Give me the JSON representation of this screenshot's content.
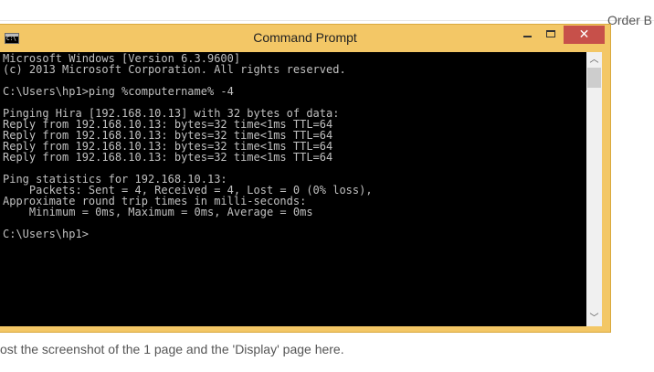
{
  "background": {
    "top_right_text": "Order B",
    "caption_text": "ost the screenshot of the 1 page and the 'Display' page here."
  },
  "window": {
    "title": "Command Prompt",
    "icon_text": "C:\\",
    "close_symbol": "✕",
    "scroll_up_symbol": "︿",
    "scroll_down_symbol": "﹀"
  },
  "console": {
    "lines": [
      "Microsoft Windows [Version 6.3.9600]",
      "(c) 2013 Microsoft Corporation. All rights reserved.",
      "",
      "C:\\Users\\hp1>ping %computername% -4",
      "",
      "Pinging Hira [192.168.10.13] with 32 bytes of data:",
      "Reply from 192.168.10.13: bytes=32 time<1ms TTL=64",
      "Reply from 192.168.10.13: bytes=32 time<1ms TTL=64",
      "Reply from 192.168.10.13: bytes=32 time<1ms TTL=64",
      "Reply from 192.168.10.13: bytes=32 time<1ms TTL=64",
      "",
      "Ping statistics for 192.168.10.13:",
      "    Packets: Sent = 4, Received = 4, Lost = 0 (0% loss),",
      "Approximate round trip times in milli-seconds:",
      "    Minimum = 0ms, Maximum = 0ms, Average = 0ms",
      "",
      "C:\\Users\\hp1>"
    ]
  },
  "colors": {
    "titlebar": "#f3c766",
    "close_button": "#c7504a",
    "console_bg": "#000000",
    "console_text": "#c0c0c0"
  }
}
